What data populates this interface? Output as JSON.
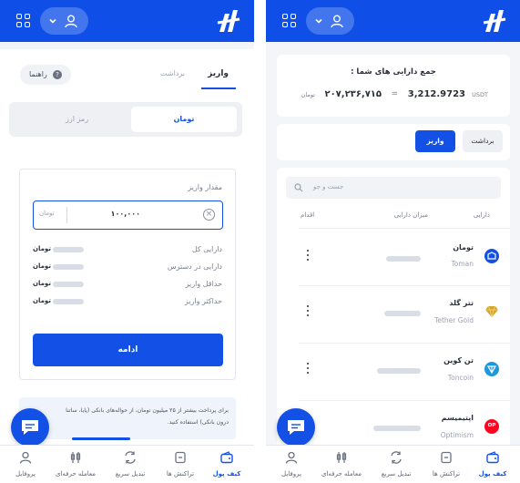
{
  "deposit_screen": {
    "tabs": {
      "deposit": "واریز",
      "withdraw": "برداشت"
    },
    "guide_label": "راهنما",
    "currency_tabs": {
      "toman": "تومان",
      "crypto": "رمز ارز"
    },
    "amount_label": "مقدار واریز",
    "amount_value": "۱۰۰,۰۰۰",
    "amount_unit": "تومان",
    "info_rows": [
      {
        "label": "دارایی کل",
        "unit": "تومان"
      },
      {
        "label": "دارایی در دسترس",
        "unit": "تومان"
      },
      {
        "label": "حداقل واریز",
        "unit": "تومان"
      },
      {
        "label": "حداکثر واریز",
        "unit": "تومان"
      }
    ],
    "continue_button": "ادامه",
    "notice_line1": "برای پرداخت بیشتر از ۲۵ میلیون تومان، از حواله‌های بانکی (پایا، ساتنا",
    "notice_line2": "درون بانکی) استفاده کنید."
  },
  "wallet_screen": {
    "total_title": "جمع دارایی های شما :",
    "total_usdt": "3,212.9723",
    "usdt_unit": "USDT",
    "equals": "=",
    "total_toman": "۲۰۷,۲۳۶,۷۱۵",
    "toman_unit": "تومان",
    "deposit_button": "واریز",
    "withdraw_button": "برداشت",
    "search_placeholder": "جست و جو",
    "columns": {
      "asset": "دارایی",
      "balance": "میزان دارایی",
      "action": "اقدام"
    },
    "assets": [
      {
        "fa": "تومان",
        "en": "Toman",
        "color": "#1350e6"
      },
      {
        "fa": "تتر گلد",
        "en": "Tether Gold",
        "color": "#d4a72c"
      },
      {
        "fa": "تن کوین",
        "en": "Toncoin",
        "color": "#1d98dc"
      },
      {
        "fa": "اپتیمیسم",
        "en": "Optimism",
        "color": "#ff0420",
        "badge": "OP"
      }
    ]
  },
  "bottom_nav": [
    {
      "label": "کیف پول",
      "icon": "wallet-icon"
    },
    {
      "label": "تراکنش ها",
      "icon": "transactions-icon"
    },
    {
      "label": "تبدیل سریع",
      "icon": "swap-icon"
    },
    {
      "label": "معامله حرفه‌ای",
      "icon": "trade-icon"
    },
    {
      "label": "پروفایل",
      "icon": "profile-icon"
    }
  ],
  "colors": {
    "primary": "#1350e6",
    "header": "#0f4fe8",
    "background": "#f3f5f9"
  }
}
